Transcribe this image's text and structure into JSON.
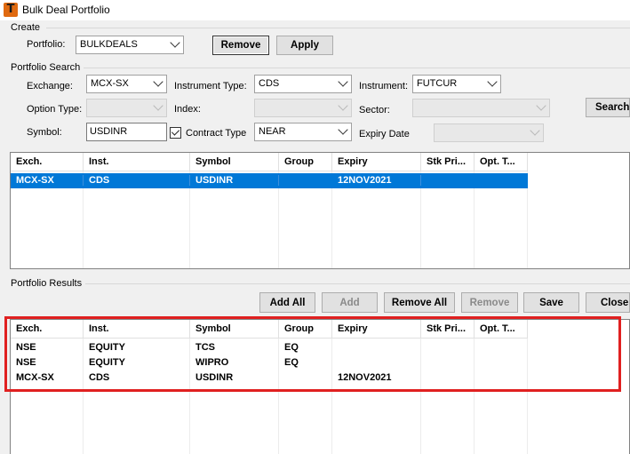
{
  "window": {
    "title": "Bulk Deal Portfolio",
    "icon": "T"
  },
  "create": {
    "group_label": "Create",
    "portfolio_label": "Portfolio:",
    "portfolio_value": "BULKDEALS",
    "remove_label": "Remove",
    "apply_label": "Apply"
  },
  "search": {
    "group_label": "Portfolio Search",
    "exchange_label": "Exchange:",
    "exchange_value": "MCX-SX",
    "instrument_type_label": "Instrument Type:",
    "instrument_type_value": "CDS",
    "instrument_label": "Instrument:",
    "instrument_value": "FUTCUR",
    "option_type_label": "Option Type:",
    "index_label": "Index:",
    "sector_label": "Sector:",
    "search_label": "Search",
    "symbol_label": "Symbol:",
    "symbol_value": "USDINR",
    "contract_type_label": "Contract Type",
    "contract_type_checked": true,
    "contract_type_value": "NEAR",
    "expiry_date_label": "Expiry Date"
  },
  "columns": [
    "Exch.",
    "Inst.",
    "Symbol",
    "Group",
    "Expiry",
    "Stk Pri...",
    "Opt. T..."
  ],
  "search_grid": {
    "rows": [
      {
        "exch": "MCX-SX",
        "inst": "CDS",
        "symbol": "USDINR",
        "group": "",
        "expiry": "12NOV2021",
        "stk": "",
        "opt": "",
        "selected": true
      }
    ]
  },
  "results": {
    "group_label": "Portfolio Results",
    "add_all_label": "Add All",
    "add_label": "Add",
    "remove_all_label": "Remove All",
    "remove_label": "Remove",
    "save_label": "Save",
    "close_label": "Close",
    "rows": [
      {
        "exch": "NSE",
        "inst": "EQUITY",
        "symbol": "TCS",
        "group": "EQ",
        "expiry": "",
        "stk": "",
        "opt": ""
      },
      {
        "exch": "NSE",
        "inst": "EQUITY",
        "symbol": "WIPRO",
        "group": "EQ",
        "expiry": "",
        "stk": "",
        "opt": ""
      },
      {
        "exch": "MCX-SX",
        "inst": "CDS",
        "symbol": "USDINR",
        "group": "",
        "expiry": "12NOV2021",
        "stk": "",
        "opt": ""
      }
    ]
  },
  "colors": {
    "highlight_border": "#e02020",
    "selection": "#0078d7",
    "app_icon": "#e06a10"
  }
}
